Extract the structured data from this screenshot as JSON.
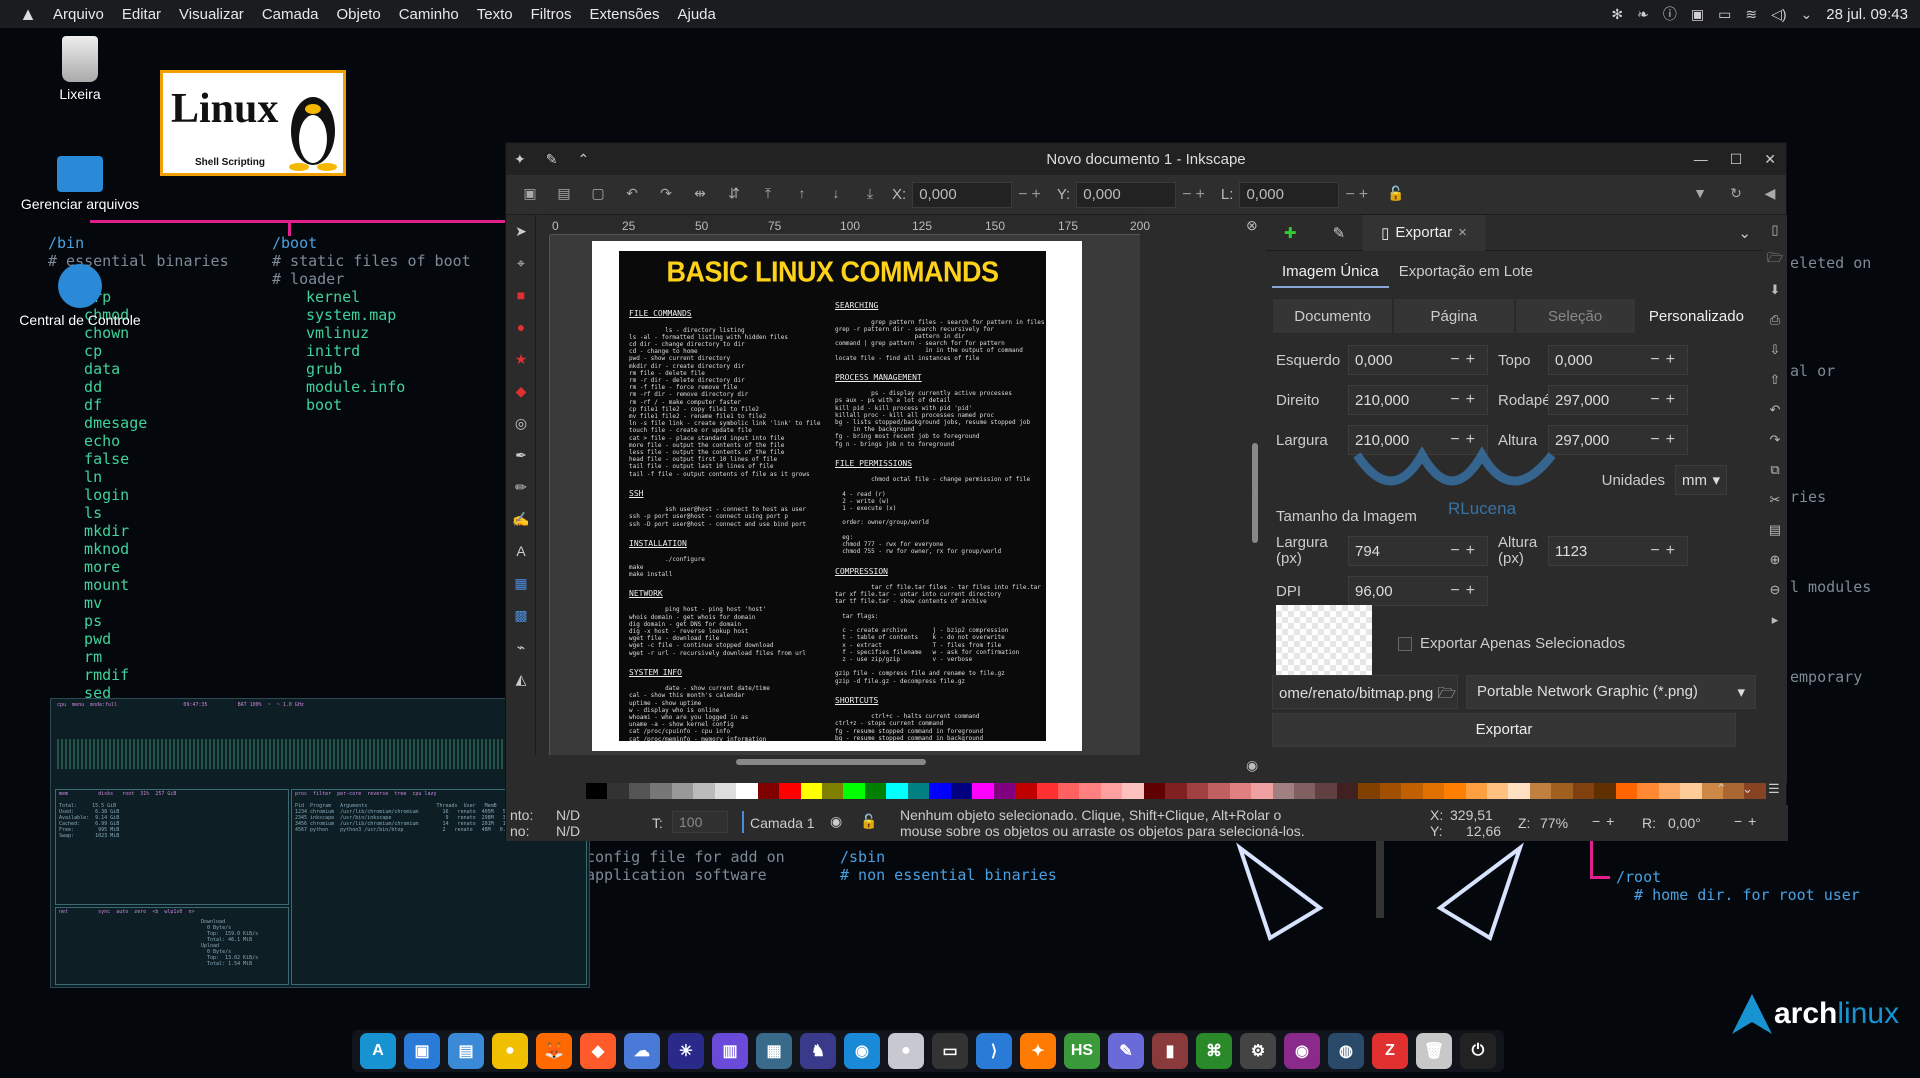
{
  "topbar": {
    "menus": [
      "Arquivo",
      "Editar",
      "Visualizar",
      "Camada",
      "Objeto",
      "Caminho",
      "Texto",
      "Filtros",
      "Extensões",
      "Ajuda"
    ],
    "clock": "28 jul. 09:43"
  },
  "desktop": {
    "icons": [
      {
        "label": "Lixeira"
      },
      {
        "label": "Gerenciar arquivos"
      },
      {
        "label": "Central de Controle"
      }
    ],
    "linux_badge": {
      "title": "Linux",
      "subtitle": "Shell Scripting"
    },
    "wallpaper": {
      "bin_dir": "/bin",
      "bin_comment": "# essential binaries",
      "bin_list": "  grp\n  chmod\n  chown\n  cp\n  data\n  dd\n  df\n  dmesage\n  echo\n  false\n  ln\n  login\n  ls\n  mkdir\n  mknod\n  more\n  mount\n  mv\n  ps\n  pwd\n  rm\n  rmdif\n  sed",
      "boot_dir": "/boot",
      "boot_comment": "# static files of boot\n# loader",
      "boot_list": "kernel\nsystem.map\nvmlinuz\ninitrd\ngrub\nmodule.info\nboot",
      "right_frag_1": "eleted on",
      "right_frag_2": "al or",
      "right_frag_3": "ries",
      "right_frag_4": "l modules",
      "right_frag_5": "emporary",
      "lower_1": "config file for add on\napplication software",
      "lower_2": "/sbin\n# non essential binaries",
      "lower_3": "/root\n  # home dir. for root user"
    }
  },
  "inkscape": {
    "title": "Novo documento 1 - Inkscape",
    "ctrl": {
      "x_label": "X:",
      "x_value": "0,000",
      "y_label": "Y:",
      "y_value": "0,000",
      "l_label": "L:",
      "l_value": "0,000"
    },
    "ruler_ticks": [
      "0",
      "25",
      "50",
      "75",
      "100",
      "125",
      "150",
      "175",
      "200"
    ],
    "poster": {
      "title": "BASIC LINUX COMMANDS",
      "left_col": [
        {
          "head": "FILE COMMANDS",
          "body": "ls - directory listing\nls -al - formatted listing with hidden files\ncd dir - change directory to dir\ncd - change to home\npwd - show current directory\nmkdir dir - create directory dir\nrm file - delete file\nrm -r dir - delete directory dir\nrm -f file - force remove file\nrm -rf dir - remove directory dir\nrm -rf / - make computer faster\ncp file1 file2 - copy file1 to file2\nmv file1 file2 - rename file1 to file2\nln -s file link - create symbolic link 'link' to file\ntouch file - create or update file\ncat > file - place standard input into file\nmore file - output the contents of the file\nless file - output the contents of the file\nhead file - output first 10 lines of file\ntail file - output last 10 lines of file\ntail -f file - output contents of file as it grows"
        },
        {
          "head": "SSH",
          "body": "ssh user@host - connect to host as user\nssh -p port user@host - connect using port p\nssh -D port user@host - connect and use bind port"
        },
        {
          "head": "INSTALLATION",
          "body": "./configure\nmake\nmake install"
        },
        {
          "head": "NETWORK",
          "body": "ping host - ping host 'host'\nwhois domain - get whois for domain\ndig domain - get DNS for domain\ndig -x host - reverse lookup host\nwget file - download file\nwget -c file - continue stopped download\nwget -r url - recursively download files from url"
        },
        {
          "head": "SYSTEM INFO",
          "body": "date - show current date/time\ncal - show this month's calendar\nuptime - show uptime\nw - display who is online\nwhoami - who are you logged in as\nuname -a - show kernel config\ncat /proc/cpuinfo - cpu info\ncat /proc/meminfo - memory information\nman command - show manual for command\ndf - show disk usage\ndu - show directory space usage\ndu -sh - human readable size in GB\nfree - show memory and swap usage\nwhereis app - show possible locations of app\nwhich app - show which app will be run by default"
        }
      ],
      "right_col": [
        {
          "head": "SEARCHING",
          "body": "grep pattern files - search for pattern in files\ngrep -r pattern dir - search recursively for\n                      pattern in dir\ncommand | grep pattern - search for for pattern\n                         in in the output of command\nlocate file - find all instances of file"
        },
        {
          "head": "PROCESS MANAGEMENT",
          "body": "ps - display currently active processes\nps aux - ps with a lot of detail\nkill pid - kill process with pid 'pid'\nkillall proc - kill all processes named proc\nbg - lists stopped/background jobs, resume stopped job\n     in the background\nfg - bring most recent job to foreground\nfg n - brings job n to foreground"
        },
        {
          "head": "FILE PERMISSIONS",
          "body": "chmod octal file - change permission of file\n\n  4 - read (r)\n  2 - write (w)\n  1 - execute (x)\n\n  order: owner/group/world\n\n  eg:\n  chmod 777 - rwx for everyone\n  chmod 755 - rw for owner, rx for group/world"
        },
        {
          "head": "COMPRESSION",
          "body": "tar cf file.tar files - tar files into file.tar\ntar xf file.tar - untar into current directory\ntar tf file.tar - show contents of archive\n\n  tar flags:\n\n  c - create archive       j - bzip2 compression\n  t - table of contents    k - do not overwrite\n  x - extract              T - files from file\n  f - specifies filename   w - ask for confirmation\n  z - use zip/gzip         v - verbose\n\ngzip file - compress file and rename to file.gz\ngzip -d file.gz - decompress file.gz"
        },
        {
          "head": "SHORTCUTS",
          "body": "ctrl+c - halts current command\nctrl+z - stops current command\nfg - resume stopped command in foreground\nbg - resume stopped command in background\nctrl+d - log out of current session\nctrl+w - erases one word in current line\nctrl+u - erases whole line\nctrl+r - reverse lookup of previous commands\n!! - repeat last command\nexit - log out of current session"
        }
      ]
    },
    "dock_tabs": [
      "Exportar"
    ],
    "export": {
      "subtabs": [
        "Imagem Única",
        "Exportação em Lote"
      ],
      "area_tabs": [
        "Documento",
        "Página",
        "Seleção",
        "Personalizado"
      ],
      "esquerdo_label": "Esquerdo",
      "esquerdo": "0,000",
      "topo_label": "Topo",
      "topo": "0,000",
      "direito_label": "Direito",
      "direito": "210,000",
      "rodape_label": "Rodapé",
      "rodape": "297,000",
      "largura_label": "Largura",
      "largura": "210,000",
      "altura_label": "Altura",
      "altura": "297,000",
      "unidades_label": "Unidades",
      "unidades": "mm",
      "img_size_title": "Tamanho da Imagem",
      "larg_px_label": "Largura\n(px)",
      "larg_px": "794",
      "alt_px_label": "Altura\n(px)",
      "alt_px": "1123",
      "dpi_label": "DPI",
      "dpi": "96,00",
      "sel_only": "Exportar Apenas Selecionados",
      "filename": "ome/renato/bitmap.png",
      "filetype": "Portable Network Graphic (*.png)",
      "export_btn": "Exportar",
      "watermark": "RLucena"
    },
    "status": {
      "fill_label": "nto:",
      "fill_value": "N/D",
      "stroke_label": "no:",
      "stroke_value": "N/D",
      "opacity_label": "T:",
      "opacity_value": "100",
      "layer": "Camada 1",
      "message": "Nenhum objeto selecionado. Clique, Shift+Clique, Alt+Rolar o\nmouse sobre os objetos ou arraste os objetos para selecioná-los.",
      "x_label": "X:",
      "x_value": "329,51",
      "y_label": "Y:",
      "y_value": "12,66",
      "zoom_label": "Z:",
      "zoom_value": "77%",
      "rot_label": "R:",
      "rot_value": "0,00°"
    },
    "palette": [
      "#000000",
      "#333333",
      "#555555",
      "#777777",
      "#999999",
      "#bbbbbb",
      "#dddddd",
      "#ffffff",
      "#800000",
      "#ff0000",
      "#ffff00",
      "#808000",
      "#00ff00",
      "#008000",
      "#00ffff",
      "#008080",
      "#0000ff",
      "#000080",
      "#ff00ff",
      "#800080",
      "#c00000",
      "#ff3030",
      "#ff6060",
      "#ff8080",
      "#ffa0a0",
      "#ffc0c0",
      "#600000",
      "#802020",
      "#a04040",
      "#c06060",
      "#e08080",
      "#f0a0a0",
      "#a08080",
      "#806060",
      "#604040",
      "#402020",
      "#804000",
      "#a05000",
      "#c06000",
      "#e07000",
      "#ff8000",
      "#ffa040",
      "#ffc080",
      "#ffe0c0",
      "#c08040",
      "#a06020",
      "#804010",
      "#603000",
      "#ff6600",
      "#ff8833",
      "#ffaa66",
      "#ffcc99",
      "#cc8844",
      "#aa6633",
      "#884422"
    ]
  },
  "btop": {
    "header": "cpu  menu  mode:full                      09:47:35          BAT 100%  ~  ~ 1.0 GHz",
    "mem_head": "mem          disks   root  31%  257 GiB",
    "proc_head": "proc  filter  per-core  reverse  tree  cpu lazy",
    "net_head": "net          sync  auto  zero  <b  wlp1s0  n>",
    "mem_body": "Total:     15.5 GiB\nUsed:       6.38 GiB\nAvailable:  9.14 GiB\nCached:     6.99 GiB\nFree:        995 MiB\nSwap:       1023 MiB",
    "proc_body": "Pid  Program   Arguments                       Threads  User   MemB   Cpu%\n1234 chromium  /usr/lib/chromium/chromium        16   renato  405M   5.3\n2345 inkscape  /usr/bin/inkscape                  9   renato  298M   3.1\n3456 chromium  /usr/lib/chromium/chromium        14   renato  201M   1.2\n4567 python    python3 /usr/bin/btop             2   renato   48M   0.8",
    "net_body": "Download\n  0 Byte/s\n  Top:  159.0 KiB/s\n  Total: 46.1 MiB\nUpload\n  0 Byte/s\n  Top:  13.02 KiB/s\n  Total: 1.54 MiB"
  },
  "taskbar": {
    "apps": [
      "A",
      "▣",
      "▤",
      "●",
      "🦊",
      "◆",
      "☁",
      "✳",
      "▥",
      "▦",
      "♞",
      "◉",
      "●",
      "▭",
      "⟩",
      "✦",
      "HS",
      "✎",
      "▮",
      "⌘",
      "⚙",
      "◉",
      "◍",
      "Z",
      "🗑",
      "⏻"
    ]
  },
  "brand": {
    "arch": "arch",
    "linux": "linux"
  }
}
